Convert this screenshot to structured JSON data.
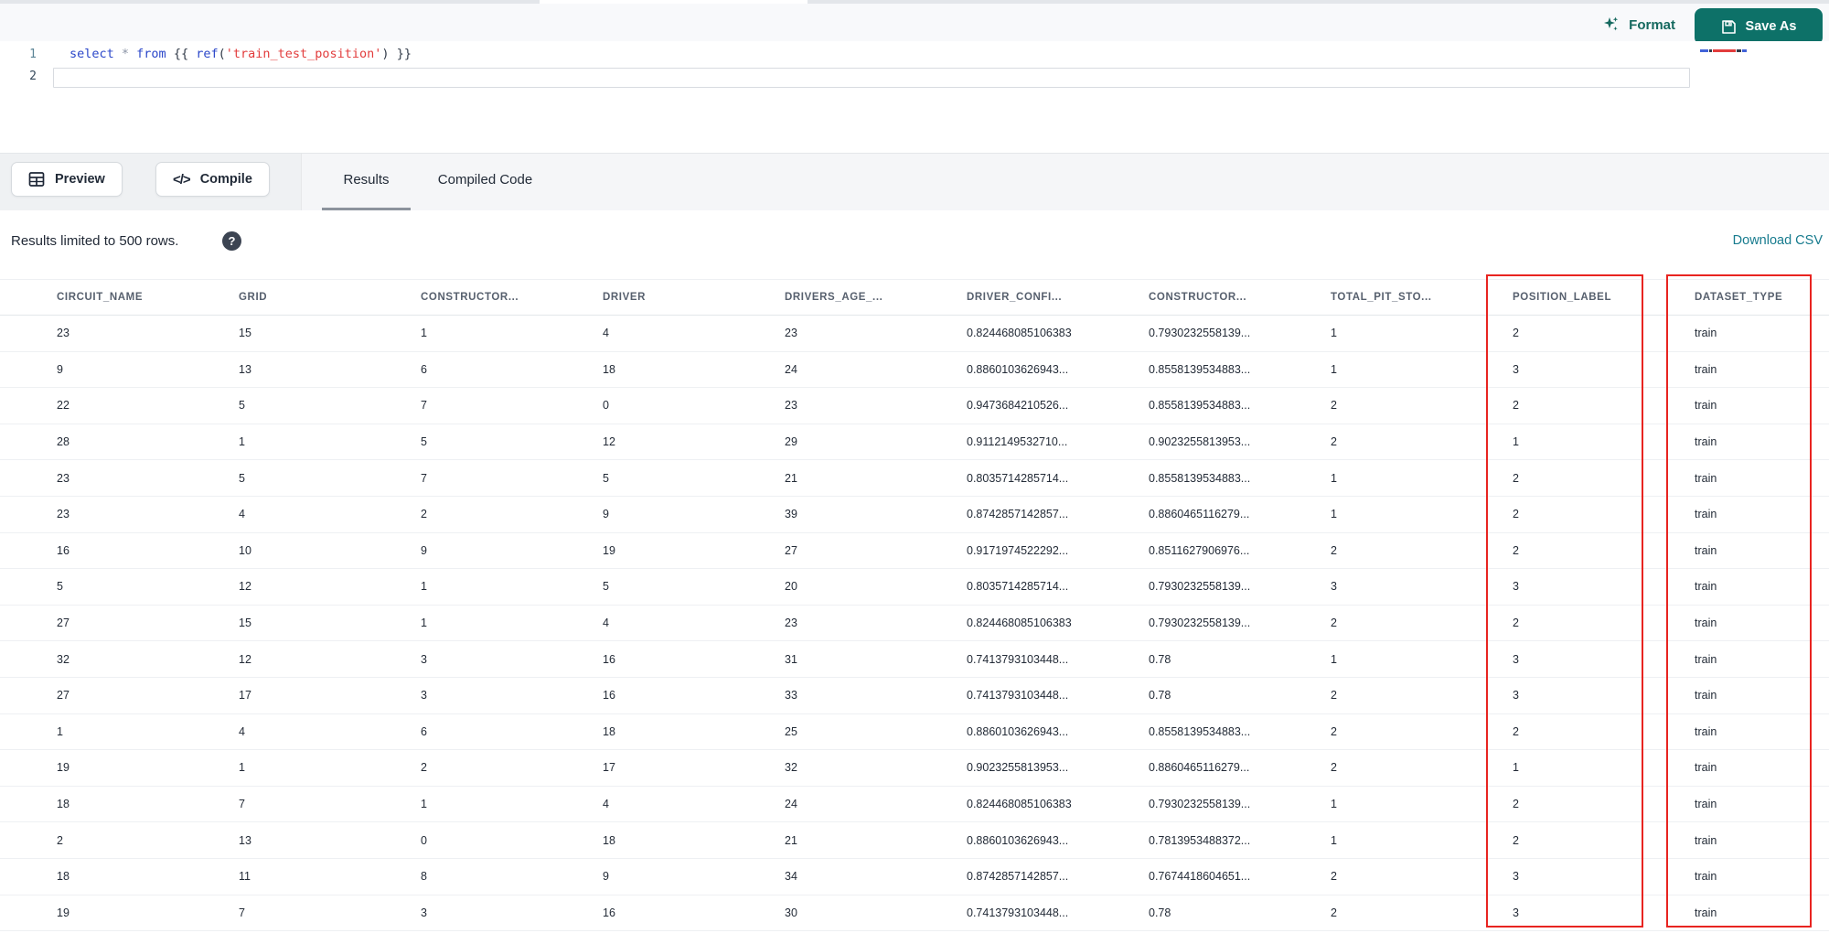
{
  "header": {
    "format_label": "Format",
    "save_as_label": "Save As"
  },
  "editor": {
    "line_numbers": [
      "1",
      "2"
    ],
    "code_text": "select * from {{ ref('train_test_position') }}",
    "code_tokens": [
      {
        "text": "select ",
        "type": "keyword"
      },
      {
        "text": "* ",
        "type": "operator"
      },
      {
        "text": "from ",
        "type": "keyword"
      },
      {
        "text": "{{ ",
        "type": "brace"
      },
      {
        "text": "ref",
        "type": "function"
      },
      {
        "text": "(",
        "type": "brace"
      },
      {
        "text": "'train_test_position'",
        "type": "string"
      },
      {
        "text": ")",
        "type": "brace"
      },
      {
        "text": " }}",
        "type": "brace"
      }
    ],
    "minimap_segments": [
      {
        "width": 9,
        "color": "#4263d8"
      },
      {
        "width": 3,
        "color": "#333c4a"
      },
      {
        "width": 25,
        "color": "#e23c3c"
      },
      {
        "width": 5,
        "color": "#333c4a"
      },
      {
        "width": 5,
        "color": "#4263d8"
      }
    ]
  },
  "toolbar": {
    "preview_label": "Preview",
    "compile_label": "Compile",
    "compile_icon_glyph": "</>",
    "tabs": [
      {
        "label": "Results",
        "active": true
      },
      {
        "label": "Compiled Code",
        "active": false
      }
    ]
  },
  "results_bar": {
    "info_text": "Results limited to 500 rows.",
    "help_glyph": "?",
    "download_label": "Download CSV"
  },
  "table": {
    "columns": [
      "CIRCUIT_NAME",
      "GRID",
      "CONSTRUCTOR...",
      "DRIVER",
      "DRIVERS_AGE_...",
      "DRIVER_CONFI...",
      "CONSTRUCTOR...",
      "TOTAL_PIT_STO...",
      "POSITION_LABEL",
      "DATASET_TYPE"
    ],
    "highlighted_columns": [
      "POSITION_LABEL",
      "DATASET_TYPE"
    ],
    "highlight_color": "#e82420",
    "rows": [
      [
        "23",
        "15",
        "1",
        "4",
        "23",
        "0.824468085106383",
        "0.7930232558139...",
        "1",
        "2",
        "train"
      ],
      [
        "9",
        "13",
        "6",
        "18",
        "24",
        "0.8860103626943...",
        "0.8558139534883...",
        "1",
        "3",
        "train"
      ],
      [
        "22",
        "5",
        "7",
        "0",
        "23",
        "0.9473684210526...",
        "0.8558139534883...",
        "2",
        "2",
        "train"
      ],
      [
        "28",
        "1",
        "5",
        "12",
        "29",
        "0.9112149532710...",
        "0.9023255813953...",
        "2",
        "1",
        "train"
      ],
      [
        "23",
        "5",
        "7",
        "5",
        "21",
        "0.8035714285714...",
        "0.8558139534883...",
        "1",
        "2",
        "train"
      ],
      [
        "23",
        "4",
        "2",
        "9",
        "39",
        "0.8742857142857...",
        "0.8860465116279...",
        "1",
        "2",
        "train"
      ],
      [
        "16",
        "10",
        "9",
        "19",
        "27",
        "0.9171974522292...",
        "0.8511627906976...",
        "2",
        "2",
        "train"
      ],
      [
        "5",
        "12",
        "1",
        "5",
        "20",
        "0.8035714285714...",
        "0.7930232558139...",
        "3",
        "3",
        "train"
      ],
      [
        "27",
        "15",
        "1",
        "4",
        "23",
        "0.824468085106383",
        "0.7930232558139...",
        "2",
        "2",
        "train"
      ],
      [
        "32",
        "12",
        "3",
        "16",
        "31",
        "0.7413793103448...",
        "0.78",
        "1",
        "3",
        "train"
      ],
      [
        "27",
        "17",
        "3",
        "16",
        "33",
        "0.7413793103448...",
        "0.78",
        "2",
        "3",
        "train"
      ],
      [
        "1",
        "4",
        "6",
        "18",
        "25",
        "0.8860103626943...",
        "0.8558139534883...",
        "2",
        "2",
        "train"
      ],
      [
        "19",
        "1",
        "2",
        "17",
        "32",
        "0.9023255813953...",
        "0.8860465116279...",
        "2",
        "1",
        "train"
      ],
      [
        "18",
        "7",
        "1",
        "4",
        "24",
        "0.824468085106383",
        "0.7930232558139...",
        "1",
        "2",
        "train"
      ],
      [
        "2",
        "13",
        "0",
        "18",
        "21",
        "0.8860103626943...",
        "0.7813953488372...",
        "1",
        "2",
        "train"
      ],
      [
        "18",
        "11",
        "8",
        "9",
        "34",
        "0.8742857142857...",
        "0.7674418604651...",
        "2",
        "3",
        "train"
      ],
      [
        "19",
        "7",
        "3",
        "16",
        "30",
        "0.7413793103448...",
        "0.78",
        "2",
        "3",
        "train"
      ]
    ]
  },
  "colors": {
    "accent_teal": "#0d7168",
    "link_teal": "#177b8e",
    "highlight_red": "#e82420",
    "keyword_blue": "#2a46c9",
    "string_red": "#e23c3c"
  }
}
